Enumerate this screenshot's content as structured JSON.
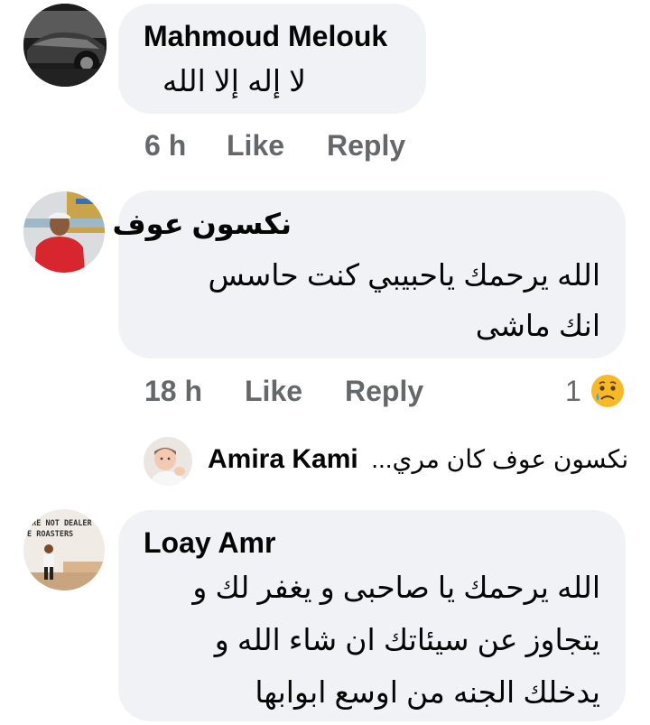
{
  "comments": [
    {
      "author": "Mahmoud Melouk",
      "text_lines": [
        "لا إله إلا الله"
      ],
      "time": "6 h",
      "like_label": "Like",
      "reply_label": "Reply"
    },
    {
      "author": "نكسون عوف",
      "text_lines": [
        "الله يرحمك ياحبيبي كنت حاسس",
        "انك ماشى"
      ],
      "time": "18 h",
      "like_label": "Like",
      "reply_label": "Reply",
      "reaction_count": "1",
      "reaction_icon": "crying-face-icon"
    },
    {
      "author": "Loay Amr",
      "avatar_text": [
        "ARE NOT DEALER",
        "E  ROASTERS"
      ],
      "text_lines": [
        "الله يرحمك يا صاحبى و يغفر لك و",
        "يتجاوز عن سيئاتك ان شاء الله و",
        "يدخلك الجنه من اوسع ابوابها"
      ]
    }
  ],
  "reply_preview": {
    "author": "Amira Kami",
    "snippet": "نكسون عوف كان مري..."
  },
  "colors": {
    "bubble": "#f0f2f5",
    "secondary_text": "#65676b",
    "primary_text": "#050505"
  }
}
